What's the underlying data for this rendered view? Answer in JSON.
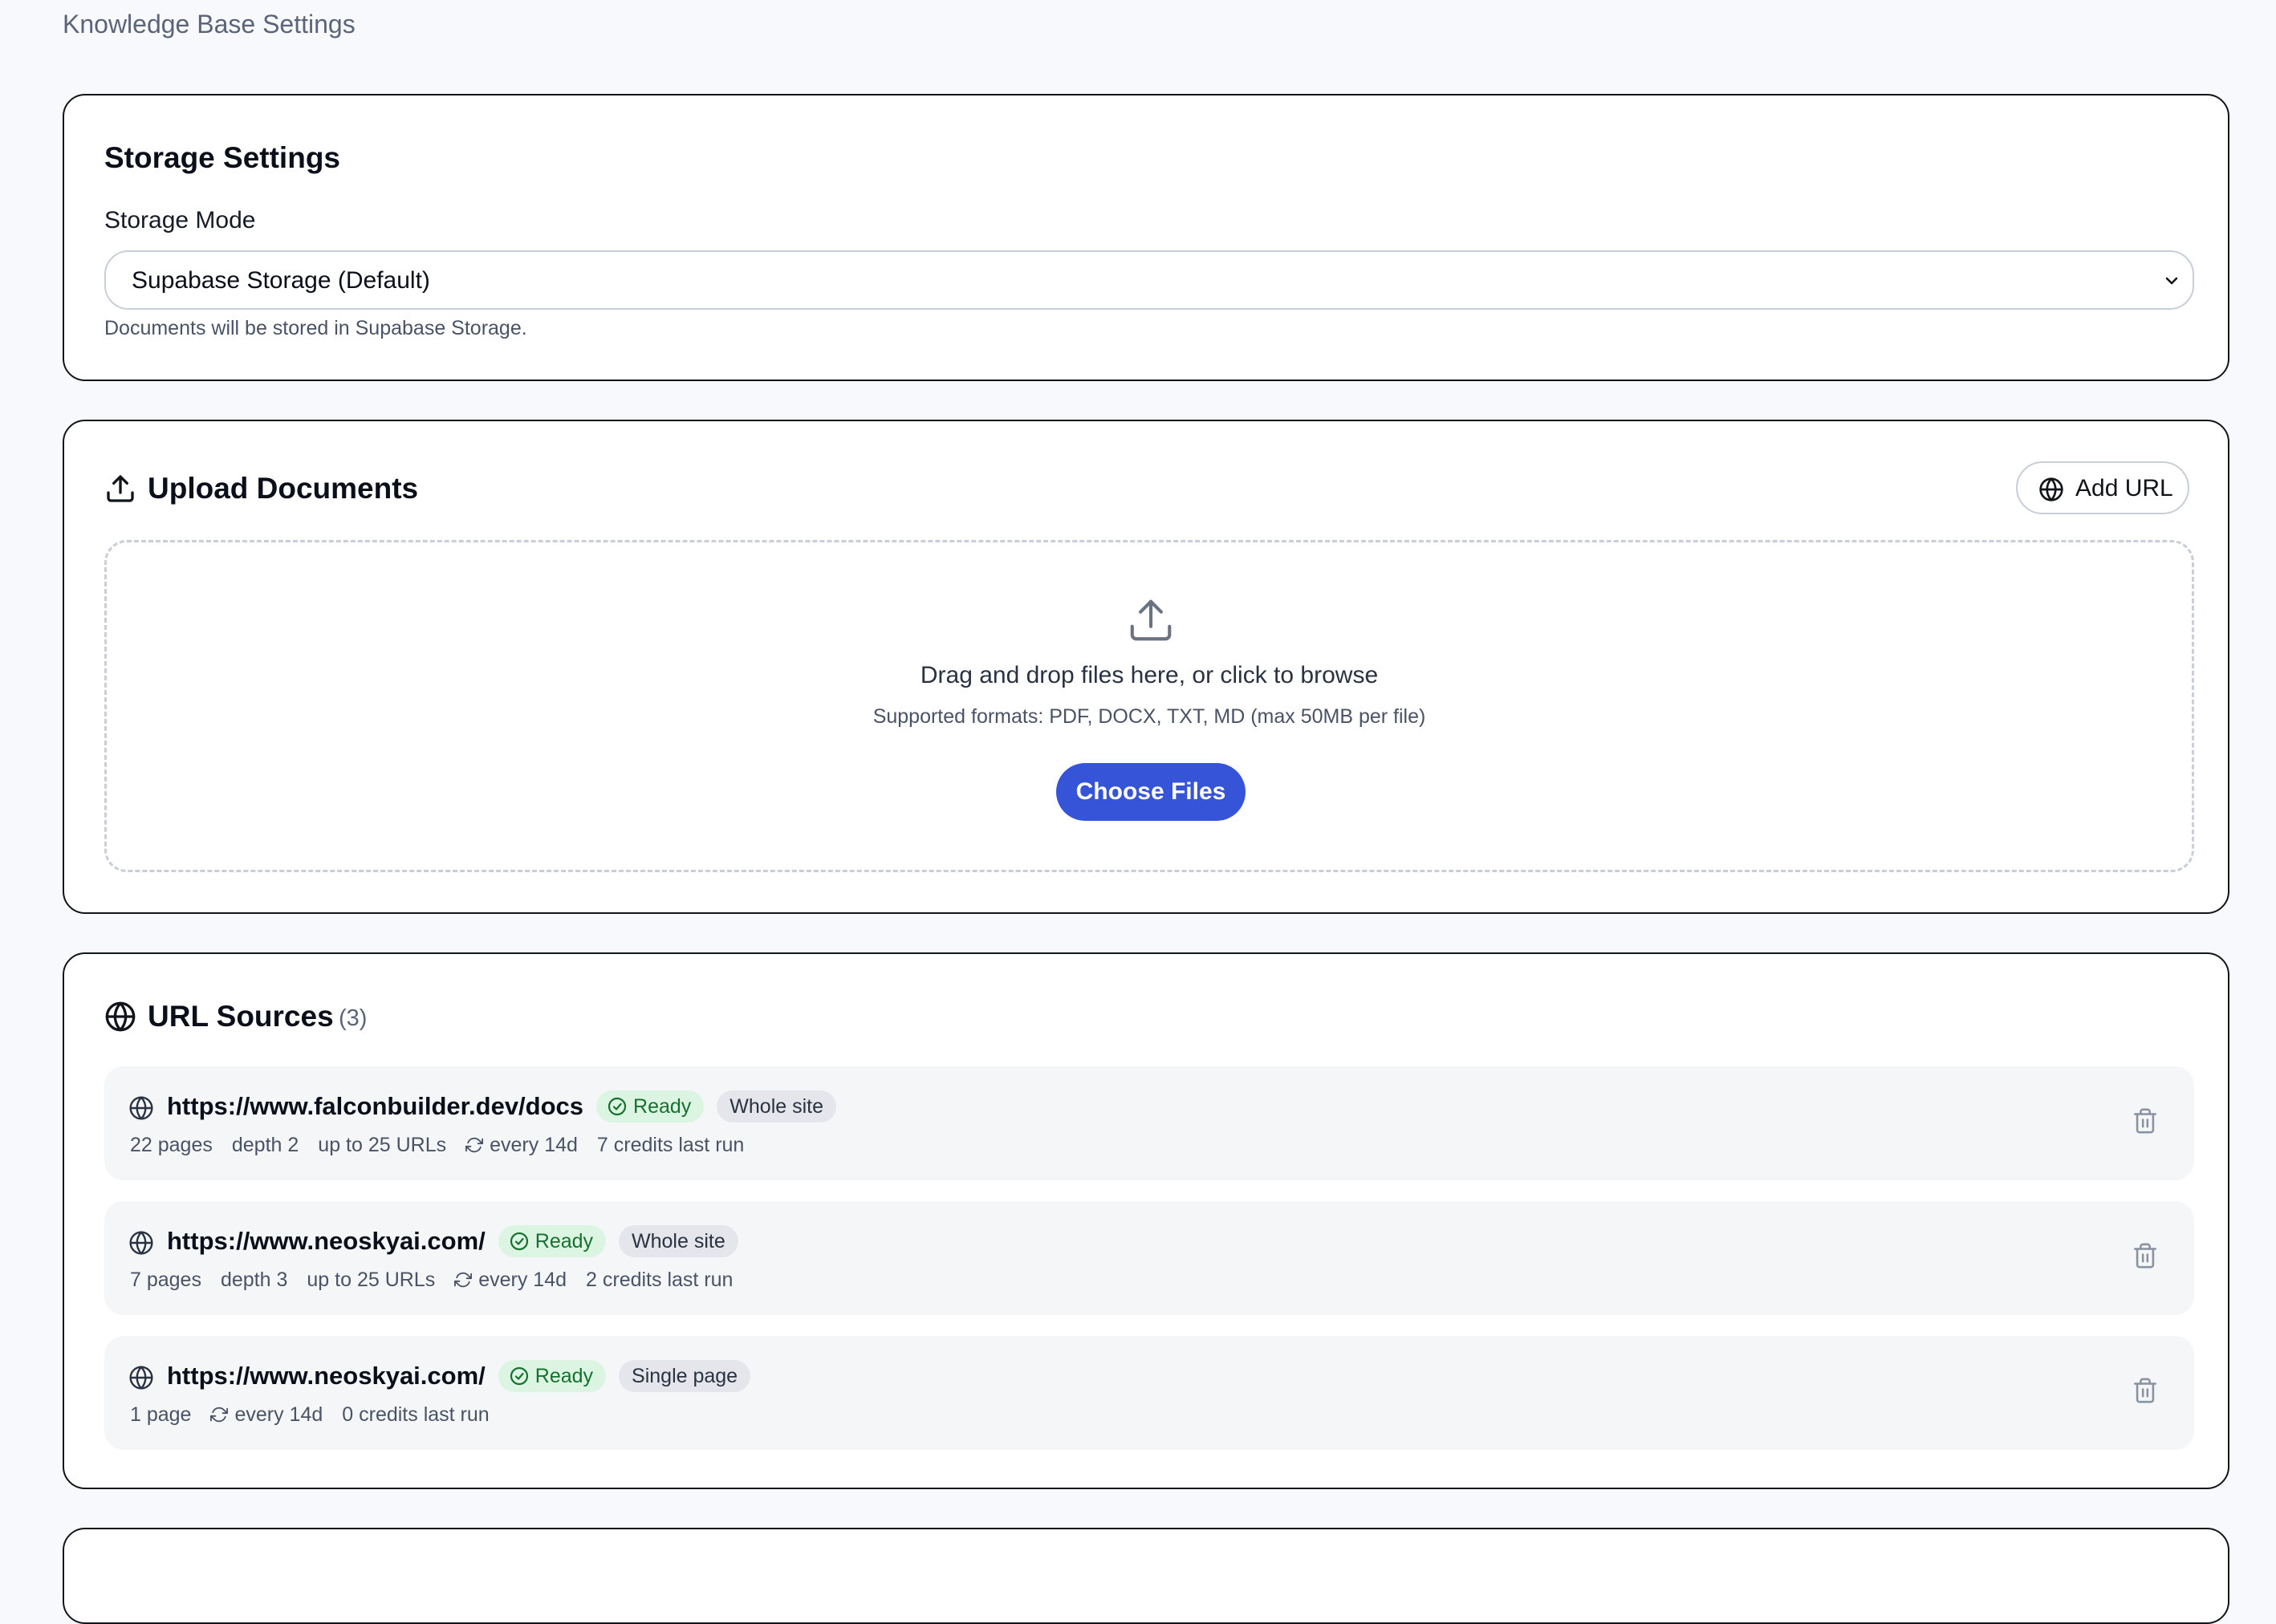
{
  "page": {
    "title": "Knowledge Base Settings"
  },
  "storage": {
    "heading": "Storage Settings",
    "mode_label": "Storage Mode",
    "selected_mode": "Supabase Storage (Default)",
    "helper": "Documents will be stored in Supabase Storage."
  },
  "upload": {
    "heading": "Upload Documents",
    "add_url_label": "Add URL",
    "dropzone_title": "Drag and drop files here, or click to browse",
    "dropzone_formats": "Supported formats: PDF, DOCX, TXT, MD (max 50MB per file)",
    "choose_files_label": "Choose Files"
  },
  "url_sources": {
    "heading": "URL Sources",
    "count": "(3)",
    "items": [
      {
        "url": "https://www.falconbuilder.dev/docs",
        "status": "Ready",
        "scope": "Whole site",
        "pages": "22 pages",
        "depth": "depth 2",
        "limit": "up to 25 URLs",
        "schedule": "every 14d",
        "credits": "7 credits last run"
      },
      {
        "url": "https://www.neoskyai.com/",
        "status": "Ready",
        "scope": "Whole site",
        "pages": "7 pages",
        "depth": "depth 3",
        "limit": "up to 25 URLs",
        "schedule": "every 14d",
        "credits": "2 credits last run"
      },
      {
        "url": "https://www.neoskyai.com/",
        "status": "Ready",
        "scope": "Single page",
        "pages": "1 page",
        "schedule": "every 14d",
        "credits": "0 credits last run"
      }
    ]
  },
  "icons": {
    "upload": "upload-icon",
    "globe": "globe-icon",
    "check": "check-circle-icon",
    "refresh": "refresh-icon",
    "delete": "trash-icon",
    "chevron": "chevron-down-icon"
  },
  "colors": {
    "primary_button": "#3554d8",
    "ready_badge_bg": "#dcf5e2",
    "ready_badge_text": "#17702f",
    "scope_badge_bg": "#e4e6eb",
    "page_bg": "#f7f9fd"
  }
}
